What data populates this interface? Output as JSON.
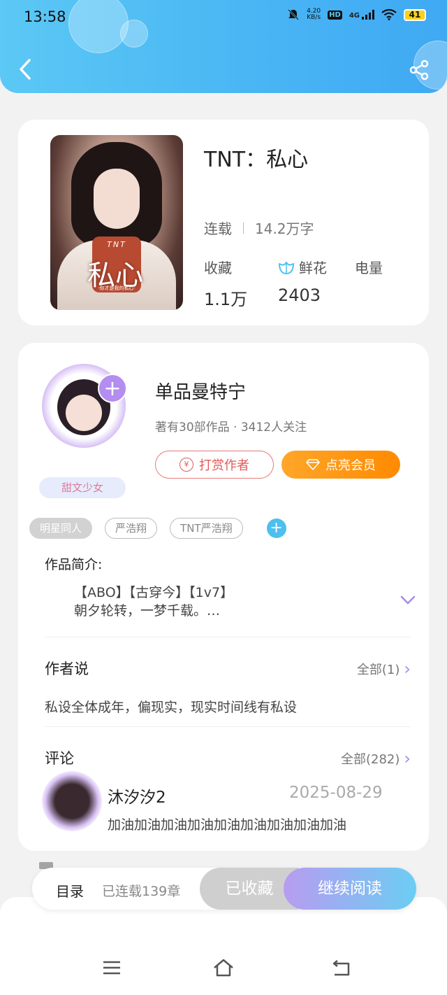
{
  "status_bar": {
    "time": "13:58",
    "net_speed_value": "4.20",
    "net_speed_unit": "KB/s",
    "hd": "HD",
    "network": "4G",
    "battery": "41"
  },
  "header": {
    "back_icon": "chevron-left-icon",
    "share_icon": "share-icon",
    "background_color": "#4ab6f4"
  },
  "book": {
    "title": "TNT：私心",
    "cover": {
      "title": "私心",
      "subtitle": "TNT",
      "caption": "·你才是我的私心·"
    },
    "status": "连载",
    "word_count": "14.2万字",
    "stats": [
      {
        "label": "收藏",
        "value": "1.1万"
      },
      {
        "label": "鲜花",
        "value": "2403",
        "icon": "flower-icon"
      },
      {
        "label": "电量",
        "value": ""
      }
    ]
  },
  "author": {
    "name": "单品曼特宁",
    "info": "著有30部作品 · 3412人关注",
    "badge": "甜文少女",
    "follow_icon": "plus-icon",
    "tip_label": "打赏作者",
    "vip_label": "点亮会员",
    "accent_color": "#b38df0"
  },
  "tags": [
    "明星同人",
    "严浩翔",
    "TNT严浩翔"
  ],
  "intro": {
    "label": "作品简介:",
    "line1": "【ABO】【古穿今】【1v7】",
    "line2": "朝夕轮转，一梦千载。…"
  },
  "author_says": {
    "title": "作者说",
    "more": "全部(1)",
    "text": "私设全体成年，偏现实，现实时间线有私设"
  },
  "comments": {
    "title": "评论",
    "more": "全部(282)",
    "items": [
      {
        "user": "沐汐汐2",
        "date": "2025-08-29",
        "text": "加油加油加油加油加油加油加油加油加油"
      }
    ]
  },
  "action_bar": {
    "toc_label": "目录",
    "toc_status": "已连载139章",
    "collected_label": "已收藏",
    "read_label": "继续阅读"
  },
  "nav_bar": {
    "icons": [
      "menu-icon",
      "home-icon",
      "back-nav-icon"
    ]
  }
}
